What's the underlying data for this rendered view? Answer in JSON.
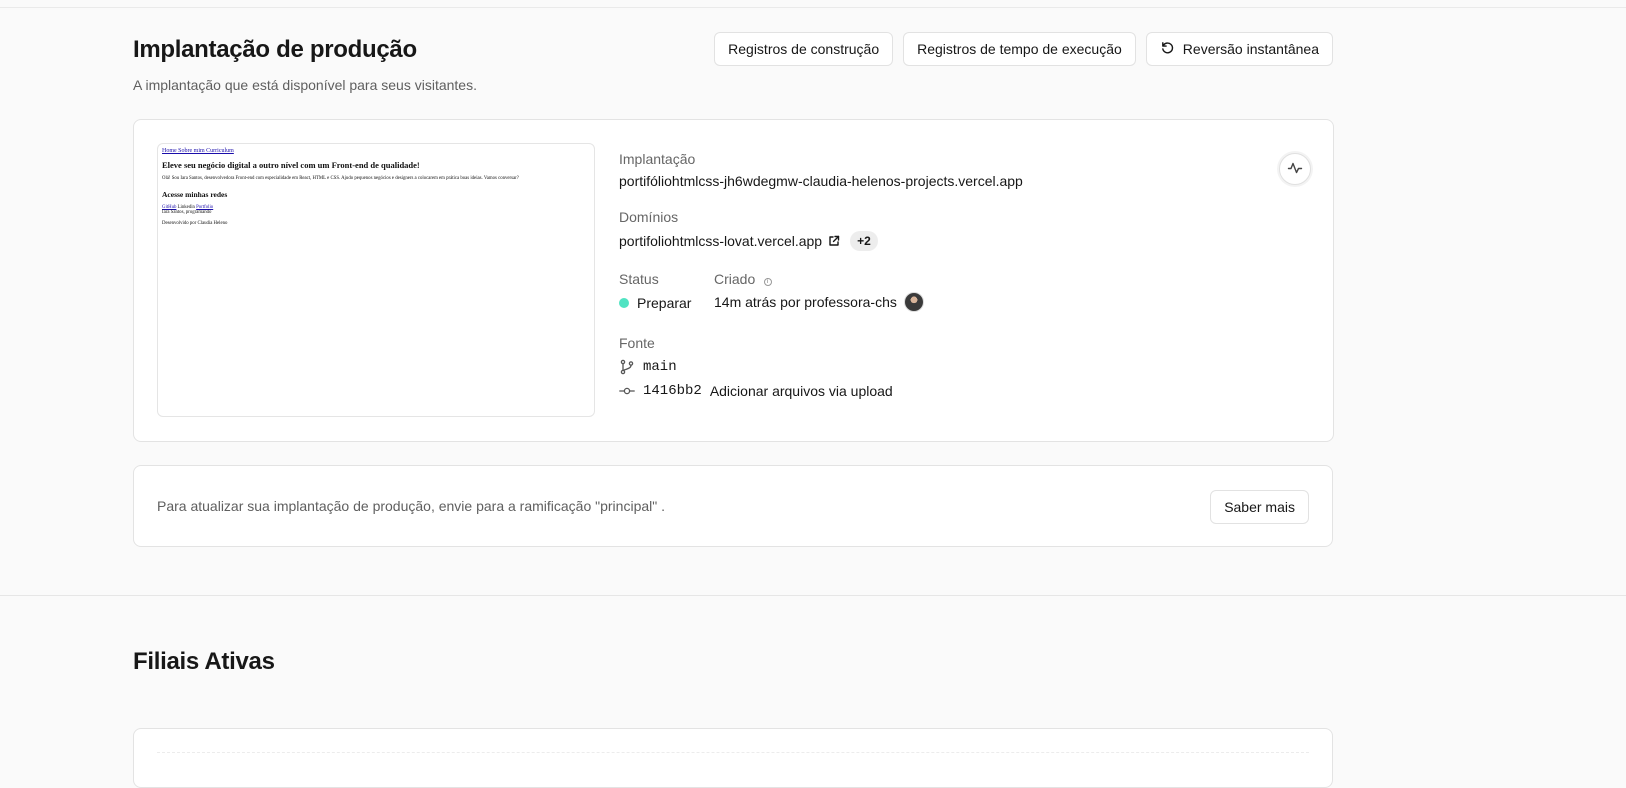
{
  "header": {
    "title": "Implantação de produção",
    "subtitle": "A implantação que está disponível para seus visitantes.",
    "actions": {
      "build_logs": "Registros de construção",
      "runtime_logs": "Registros de tempo de execução",
      "instant_rollback": "Reversão instantânea"
    }
  },
  "preview": {
    "nav": "Home Sobre mim Curriculum",
    "heading": "Eleve seu negócio digital a outro nível com um Front-end de qualidade!",
    "paragraph": "Olá! Sou Iara Santos, desenvolvedora Front-end com especialidade em React, HTML e CSS. Ajudo pequenos negócios e designers a colocarem em prática boas ideias. Vamos conversar?",
    "subheading": "Acesse minhas redes",
    "links": [
      "GitHub",
      "Linkedin",
      "Portfolio"
    ],
    "alt_text": "Iara Santos, programando",
    "footer": "Desenvolvido por Claudia Heleno"
  },
  "deployment": {
    "label": "Implantação",
    "url": "portifóliohtmlcss-jh6wdegmw-claudia-helenos-projects.vercel.app"
  },
  "domains": {
    "label": "Domínios",
    "primary": "portifoliohtmlcss-lovat.vercel.app",
    "extra_count": "+2"
  },
  "status": {
    "label": "Status",
    "value": "Preparar",
    "color": "#50e3c2"
  },
  "created": {
    "label": "Criado",
    "value": "14m atrás por professora-chs"
  },
  "source": {
    "label": "Fonte",
    "branch": "main",
    "commit_hash": "1416bb2",
    "commit_message": "Adicionar arquivos via upload"
  },
  "notice": {
    "text": "Para atualizar sua implantação de produção, envie para a ramificação \"principal\" .",
    "button": "Saber mais"
  },
  "branches": {
    "title": "Filiais Ativas"
  },
  "icons": [
    "rollback-icon",
    "external-link-icon",
    "info-icon",
    "branch-icon",
    "commit-icon",
    "activity-icon"
  ]
}
